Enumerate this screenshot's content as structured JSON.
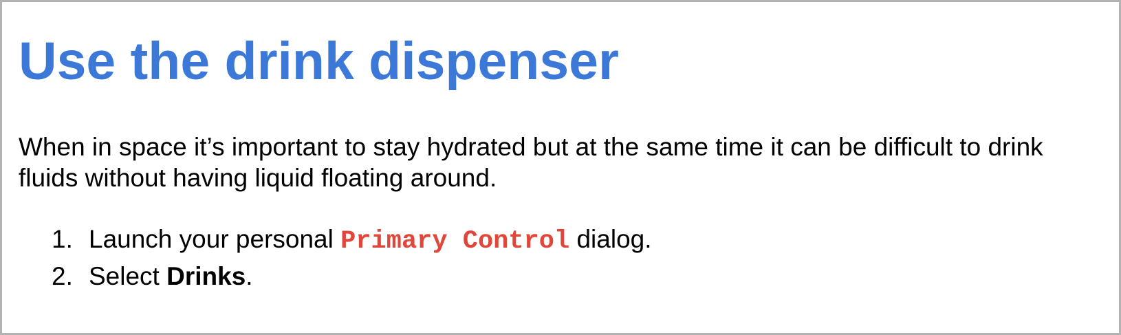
{
  "document": {
    "title": "Use the drink dispenser",
    "intro": "When in space it’s important to stay hydrated but at the same time it can be difficult to drink fluids without having liquid floating around.",
    "steps": [
      {
        "number": "1.",
        "prefix": "Launch your personal ",
        "code": "Primary Control",
        "suffix": " dialog."
      },
      {
        "number": "2.",
        "prefix": "Select ",
        "bold": "Drinks",
        "suffix": "."
      }
    ]
  },
  "colors": {
    "title": "#3c78d8",
    "code": "#e0473a",
    "border": "#b3b3b3"
  }
}
